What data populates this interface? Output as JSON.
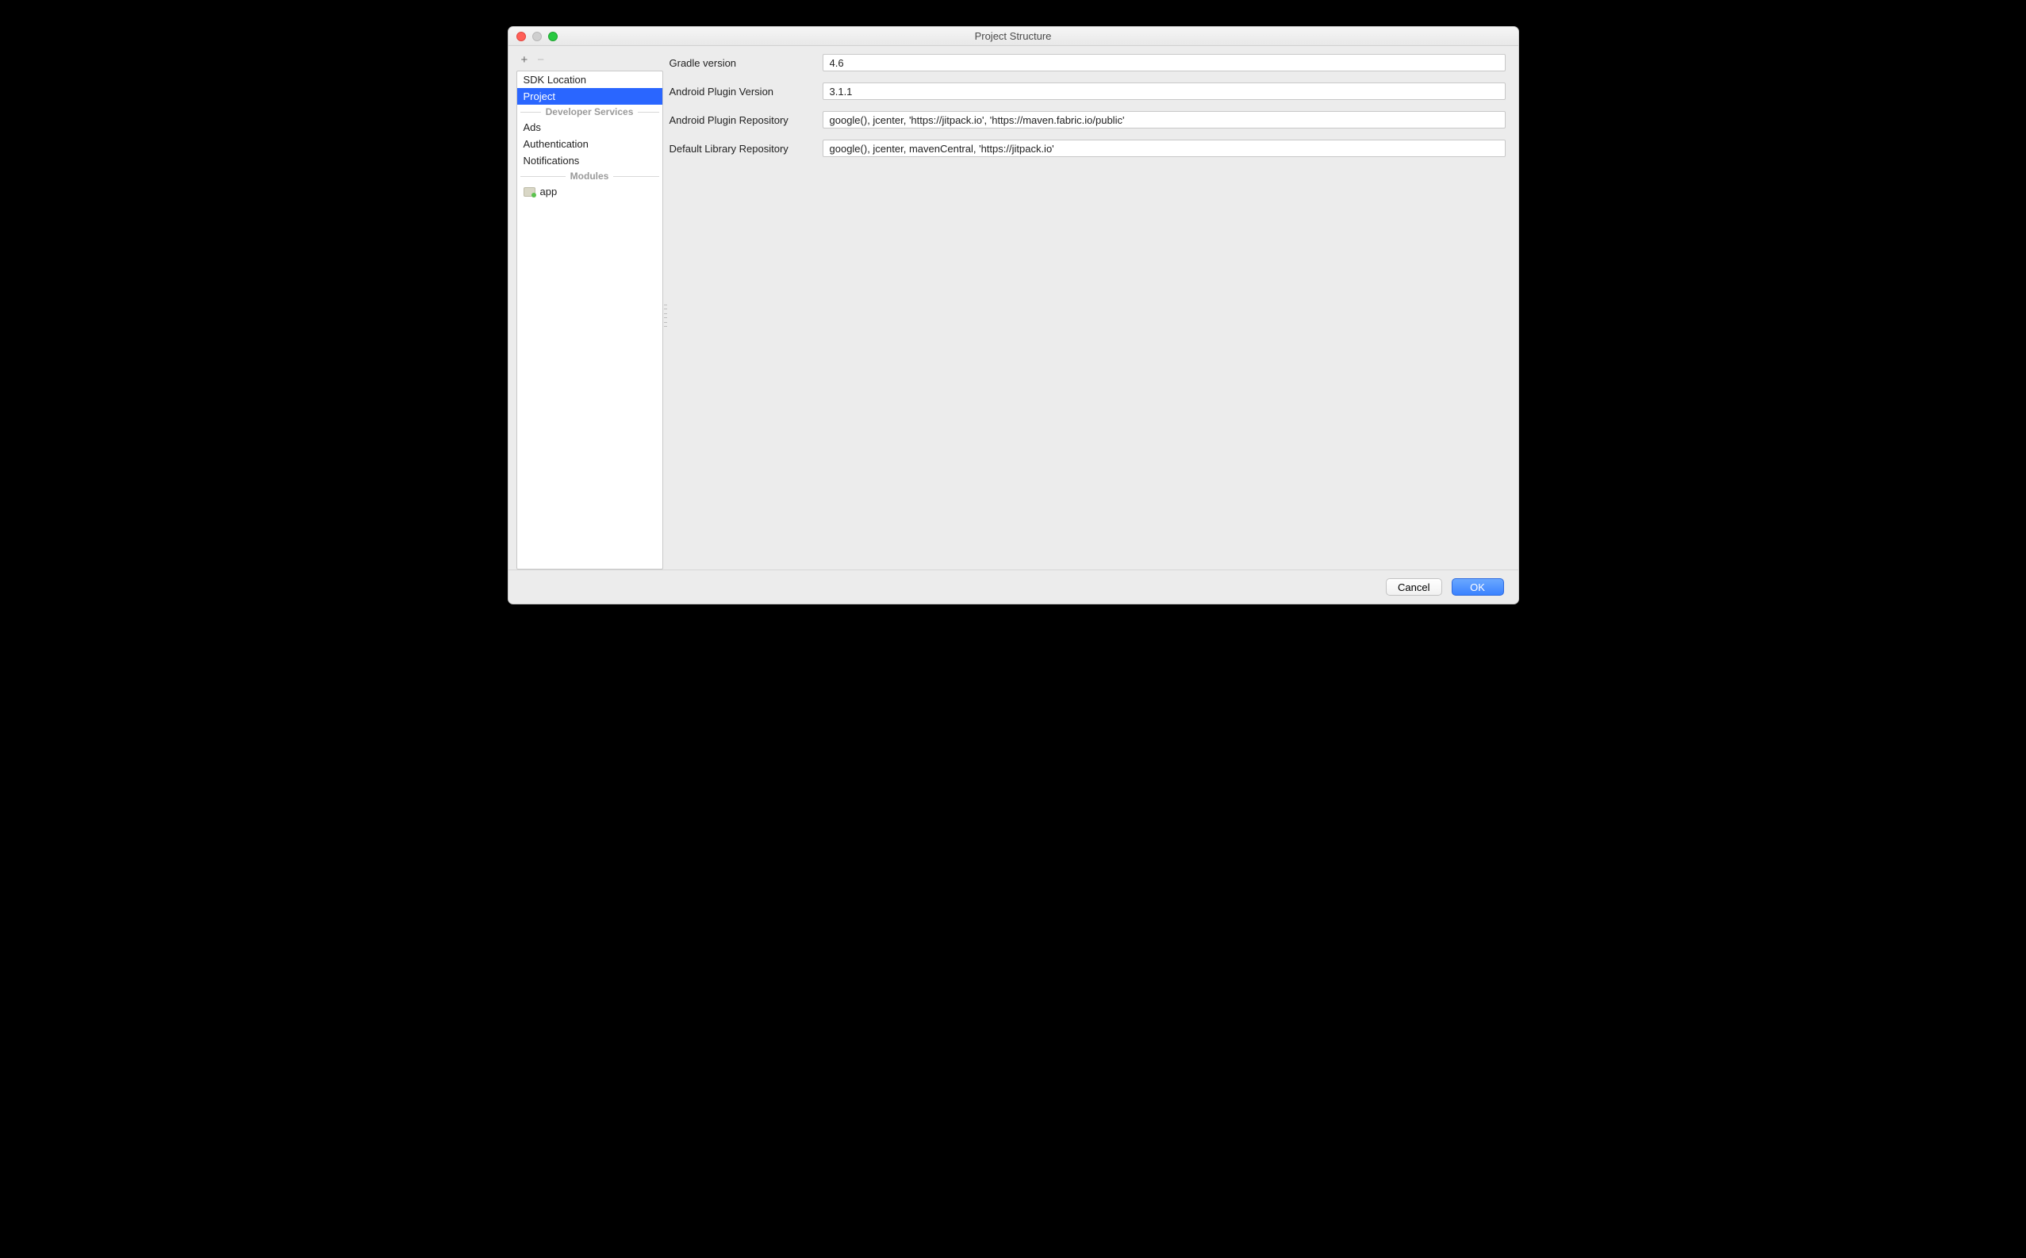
{
  "window": {
    "title": "Project Structure"
  },
  "sidebar": {
    "top": [
      {
        "label": "SDK Location",
        "selected": false
      },
      {
        "label": "Project",
        "selected": true
      }
    ],
    "sep1": "Developer Services",
    "services": [
      {
        "label": "Ads"
      },
      {
        "label": "Authentication"
      },
      {
        "label": "Notifications"
      }
    ],
    "sep2": "Modules",
    "modules": [
      {
        "label": "app"
      }
    ]
  },
  "form": {
    "gradle_label": "Gradle version",
    "gradle_value": "4.6",
    "plugin_label": "Android Plugin Version",
    "plugin_value": "3.1.1",
    "plugin_repo_label": "Android Plugin Repository",
    "plugin_repo_value": "google(), jcenter, 'https://jitpack.io', 'https://maven.fabric.io/public'",
    "lib_repo_label": "Default Library Repository",
    "lib_repo_value": "google(), jcenter, mavenCentral, 'https://jitpack.io'"
  },
  "footer": {
    "cancel": "Cancel",
    "ok": "OK"
  }
}
